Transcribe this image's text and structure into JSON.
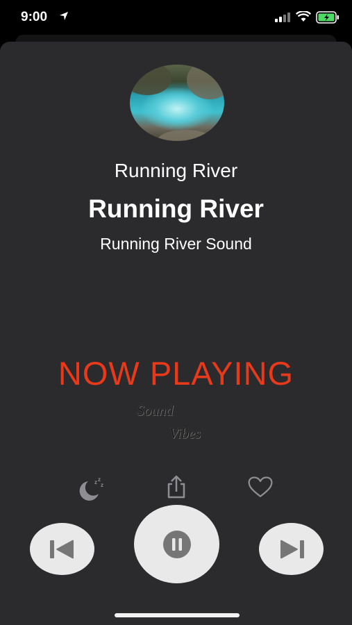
{
  "status_bar": {
    "time": "9:00"
  },
  "artwork": {
    "alt": "river pool photo"
  },
  "track": {
    "subtitle": "Running River",
    "title": "Running River",
    "artist": "Running River Sound"
  },
  "now_playing_label": "NOW PLAYING",
  "brand": {
    "line1": "Sound",
    "line2": "Vibes"
  },
  "actions": {
    "sleep_icon": "moon-zzz-icon",
    "share_icon": "share-icon",
    "favorite_icon": "heart-icon"
  },
  "controls": {
    "previous_icon": "skip-back-icon",
    "pause_icon": "pause-icon",
    "next_icon": "skip-forward-icon"
  },
  "colors": {
    "accent": "#e8391b",
    "sheet": "#2b2b2d",
    "button": "#e9e9ea",
    "battery": "#4cd964"
  }
}
